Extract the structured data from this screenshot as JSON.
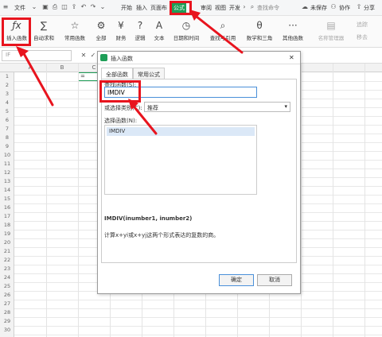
{
  "menubar": {
    "file": "文件",
    "items": [
      "开始",
      "插入",
      "页面布",
      "公式",
      "审阅",
      "视图",
      "开发"
    ],
    "active_index": 3,
    "search_placeholder": "查找命令",
    "unsaved": "未保存",
    "collab": "协作",
    "share": "分享"
  },
  "ribbon": {
    "buttons": [
      {
        "label": "插入函数",
        "icon": "ƒx"
      },
      {
        "label": "自动求和",
        "icon": "∑"
      },
      {
        "label": "常用函数",
        "icon": "☆"
      },
      {
        "label": "全部",
        "icon": "⚙"
      },
      {
        "label": "财务",
        "icon": "¥"
      },
      {
        "label": "逻辑",
        "icon": "?"
      },
      {
        "label": "文本",
        "icon": "A"
      },
      {
        "label": "日期和时间",
        "icon": "◷"
      },
      {
        "label": "查找与引用",
        "icon": "⌕"
      },
      {
        "label": "数学和三角",
        "icon": "θ"
      },
      {
        "label": "其他函数",
        "icon": "···"
      },
      {
        "label": "名称管理器",
        "icon": "▤"
      }
    ],
    "right_labels": [
      "追踪",
      "移去"
    ]
  },
  "formula_bar": {
    "namebox": "IF"
  },
  "grid": {
    "columns": [
      "A",
      "B",
      "C",
      "",
      "",
      "",
      "",
      "",
      "",
      "",
      "",
      ""
    ],
    "rows": [
      "1",
      "2",
      "3",
      "4",
      "5",
      "6",
      "7",
      "8",
      "9",
      "10",
      "11",
      "12",
      "13",
      "14",
      "15",
      "16",
      "17",
      "18",
      "19",
      "20",
      "21",
      "22",
      "23",
      "24",
      "25",
      "26",
      "27",
      "28",
      "29",
      "30"
    ],
    "cell_c1": "="
  },
  "dialog": {
    "title": "插入函数",
    "tabs": [
      "全部函数",
      "常用公式"
    ],
    "search_label": "查找函数(S):",
    "search_value": "IMDIV",
    "category_label": "或选择类别(C):",
    "category_value": "推荐",
    "select_label": "选择函数(N):",
    "functions": [
      "IMDIV"
    ],
    "signature": "IMDIV(inumber1, inumber2)",
    "description": "计算x+yi或x+yj这两个形式表达的复数的商。",
    "ok": "确定",
    "cancel": "取消"
  },
  "colors": {
    "accent_green": "#1e9e57",
    "annotation_red": "#e8141e",
    "highlight_blue": "#dbe8f7"
  }
}
